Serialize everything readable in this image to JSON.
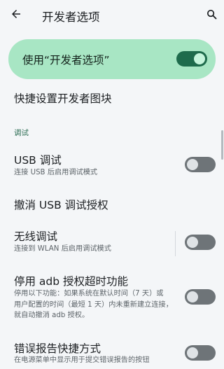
{
  "appbar": {
    "title": "开发者选项",
    "back_icon": "arrow-back-icon",
    "search_icon": "search-icon"
  },
  "master": {
    "label": "使用“开发者选项”",
    "enabled": true
  },
  "quick_settings_tiles": {
    "label": "快捷设置开发者图块"
  },
  "section": {
    "debugging": "调试"
  },
  "usb_debugging": {
    "title": "USB 调试",
    "subtitle": "连接 USB 后启用调试模式",
    "enabled": false
  },
  "revoke_usb": {
    "title": "撤消 USB 调试授权"
  },
  "wireless_debugging": {
    "title": "无线调试",
    "subtitle": "连接到 WLAN 后启用调试模式",
    "enabled": false
  },
  "adb_timeout": {
    "title": "停用 adb 授权超时功能",
    "subtitle_lines": [
      "停用以下功能：如果系统在默认时间（7 天）或",
      "用户配置的时间（最短 1 天）内未重新建立连接，",
      "就自动撤消 adb 授权。"
    ],
    "enabled": false
  },
  "bug_report": {
    "title": "错误报告快捷方式",
    "subtitle": "在电源菜单中显示用于提交错误报告的按钮",
    "enabled": false
  },
  "colors": {
    "accent_card": "#a8e6c4",
    "toggle_on": "#1e6b4c",
    "toggle_off": "#6e7478",
    "section_header": "#2b6c52",
    "background": "#f4f6f8"
  }
}
